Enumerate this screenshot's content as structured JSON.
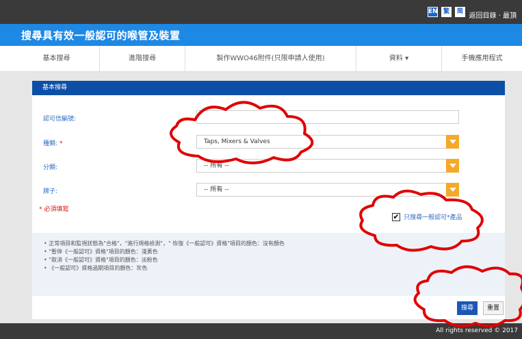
{
  "header": {
    "lang_en": "EN",
    "lang_tc": "繁",
    "lang_sc": "简",
    "links": "返回目錄 · 最頂"
  },
  "title": "搜尋具有效一般認可的喉管及裝置",
  "nav": [
    {
      "label": "基本搜尋"
    },
    {
      "label": "進階搜尋"
    },
    {
      "label": "製作WWO46附件(只限申請人使用)"
    },
    {
      "label": "資料 ▾"
    },
    {
      "label": "手機應用程式"
    }
  ],
  "panel": {
    "heading": "基本搜尋",
    "fields": {
      "approval_label": "認可信編號:",
      "approval_value": "",
      "type_label": "種類:",
      "type_required_mark": "*",
      "type_value": "Taps, Mixers & Valves",
      "category_label": "分類:",
      "category_value": "-- 所有 --",
      "brand_label": "牌子:",
      "brand_value": "-- 所有 --"
    },
    "required_note": "* 必須填寫",
    "checkbox_label": "只搜尋一般認可*產品",
    "checkbox_mark": "✔",
    "notes": [
      "• 正常項目和監視狀態為\"合格\"，\"進行規格檢測\"，\" 恢復《一般認可》資格\"項目的顏色：沒有顏色",
      "• \"暫停《一般認可》資格\"項目的顏色：淺黃色",
      "• \"取消《一般認可》資格\"項目的顏色：淡粉色",
      "• 《一般認可》資格過期項目的顏色：灰色"
    ],
    "search_button": "搜尋",
    "reset_button": "重置"
  },
  "footer": {
    "copyright": "All rights reserved © 2017"
  },
  "colors": {
    "title_bar": "#1e88e5",
    "panel_header": "#0d4ea6",
    "dropdown_arrow": "#f6a827",
    "annotation": "#e00000"
  }
}
